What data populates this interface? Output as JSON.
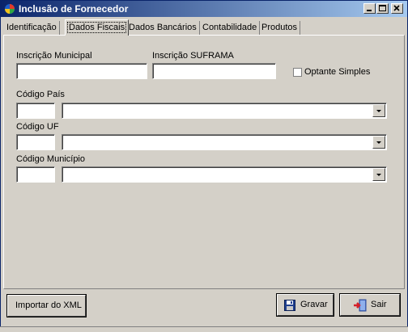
{
  "window": {
    "title": "Inclusão de Fornecedor"
  },
  "tabs": [
    {
      "label": "Identificação"
    },
    {
      "label": "Dados Fiscais"
    },
    {
      "label": "Dados Bancários"
    },
    {
      "label": "Contabilidade"
    },
    {
      "label": "Produtos"
    }
  ],
  "form": {
    "inscricao_municipal_label": "Inscrição Municipal",
    "inscricao_municipal_value": "",
    "inscricao_suframa_label": "Inscrição SUFRAMA",
    "inscricao_suframa_value": "",
    "optante_simples_label": "Optante Simples",
    "optante_simples_checked": false,
    "codigo_pais_label": "Código País",
    "codigo_pais_value": "",
    "pais_selected": "",
    "codigo_uf_label": "Código UF",
    "codigo_uf_value": "",
    "uf_selected": "",
    "codigo_municipio_label": "Código Município",
    "codigo_municipio_value": "",
    "municipio_selected": ""
  },
  "buttons": {
    "importar_xml": "Importar do XML",
    "gravar": "Gravar",
    "sair": "Sair"
  }
}
